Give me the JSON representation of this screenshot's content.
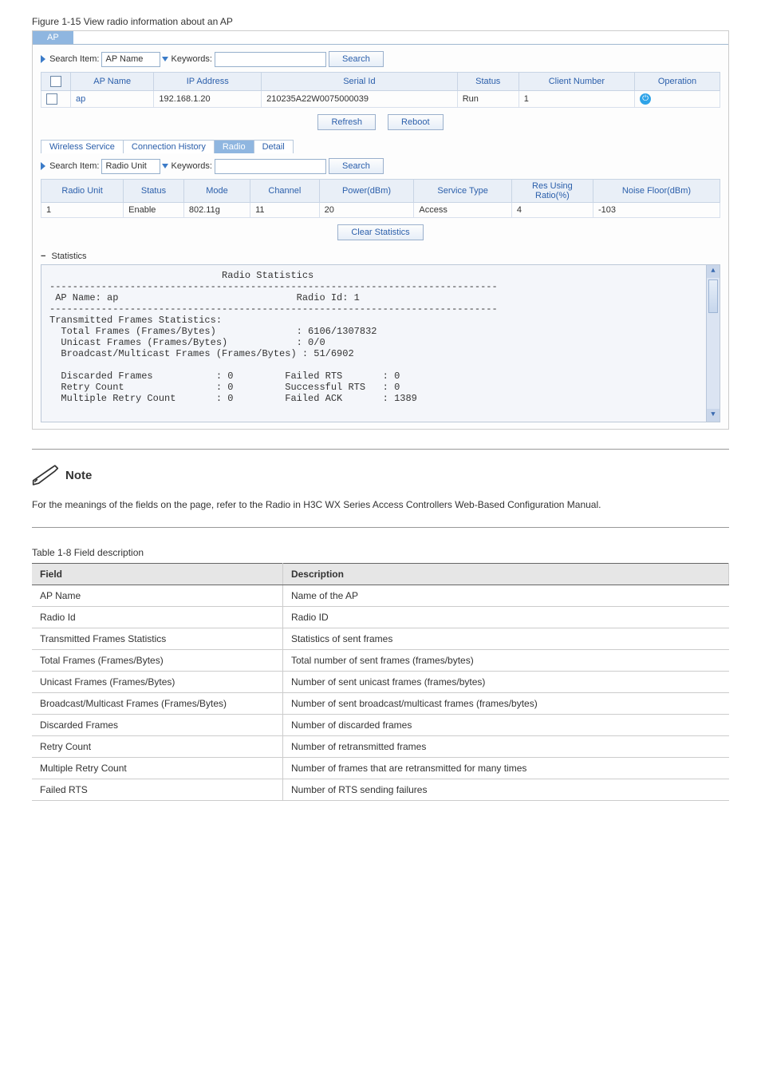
{
  "figcap": "Figure 1-15 View radio information about an AP",
  "top_tab": "AP",
  "search1": {
    "label": "Search Item:",
    "select": "AP Name",
    "kwlabel": "Keywords:",
    "btn": "Search"
  },
  "grid1": {
    "headers": [
      "",
      "AP Name",
      "IP Address",
      "Serial Id",
      "Status",
      "Client Number",
      "Operation"
    ],
    "row": [
      "",
      "ap",
      "192.168.1.20",
      "210235A22W0075000039",
      "Run",
      "1",
      ""
    ]
  },
  "btns1": {
    "refresh": "Refresh",
    "reboot": "Reboot"
  },
  "subtabs": [
    "Wireless Service",
    "Connection History",
    "Radio",
    "Detail"
  ],
  "search2": {
    "label": "Search Item:",
    "select": "Radio Unit",
    "kwlabel": "Keywords:",
    "btn": "Search"
  },
  "grid2": {
    "headers": [
      "Radio Unit",
      "Status",
      "Mode",
      "Channel",
      "Power(dBm)",
      "Service Type",
      "Res Using\nRatio(%)",
      "Noise Floor(dBm)"
    ],
    "row": [
      "1",
      "Enable",
      "802.11g",
      "11",
      "20",
      "Access",
      "4",
      "-103"
    ]
  },
  "clearbtn": "Clear Statistics",
  "statlabel": "Statistics",
  "stat_text": "                              Radio Statistics\n------------------------------------------------------------------------------\n AP Name: ap                               Radio Id: 1\n------------------------------------------------------------------------------\nTransmitted Frames Statistics:\n  Total Frames (Frames/Bytes)              : 6106/1307832\n  Unicast Frames (Frames/Bytes)            : 0/0\n  Broadcast/Multicast Frames (Frames/Bytes) : 51/6902\n\n  Discarded Frames           : 0         Failed RTS       : 0\n  Retry Count                : 0         Successful RTS   : 0\n  Multiple Retry Count       : 0         Failed ACK       : 1389",
  "note_label": "Note",
  "note_body": "For the meanings of the fields on the page, refer to the Radio in H3C WX Series Access Controllers Web-Based Configuration Manual.",
  "tablecap": "Table 1-8 Field description",
  "desc": {
    "h1": "Field",
    "h2": "Description",
    "rows": [
      [
        "AP Name",
        "Name of the AP"
      ],
      [
        "Radio Id",
        "Radio ID"
      ],
      [
        "Transmitted Frames Statistics",
        "Statistics of sent frames"
      ],
      [
        "Total Frames (Frames/Bytes)",
        "Total number of sent frames (frames/bytes)"
      ],
      [
        "Unicast Frames (Frames/Bytes)",
        "Number of sent unicast frames (frames/bytes)"
      ],
      [
        "Broadcast/Multicast Frames (Frames/Bytes)",
        "Number of sent broadcast/multicast frames (frames/bytes)"
      ],
      [
        "Discarded Frames",
        "Number of discarded frames"
      ],
      [
        "Retry Count",
        "Number of retransmitted frames"
      ],
      [
        "Multiple Retry Count",
        "Number of frames that are retransmitted for many times"
      ],
      [
        "Failed RTS",
        "Number of RTS sending failures"
      ]
    ]
  }
}
